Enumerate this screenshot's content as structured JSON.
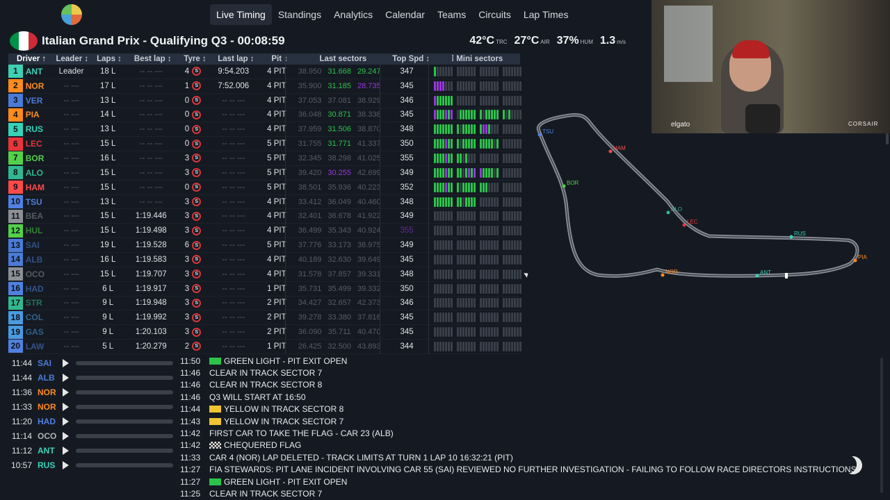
{
  "nav": {
    "items": [
      {
        "label": "Live Timing",
        "active": true
      },
      {
        "label": "Standings"
      },
      {
        "label": "Analytics"
      },
      {
        "label": "Calendar"
      },
      {
        "label": "Teams"
      },
      {
        "label": "Circuits"
      },
      {
        "label": "Lap Times"
      }
    ]
  },
  "session": {
    "title": "Italian Grand Prix - Qualifying Q3 - 00:08:59",
    "flag_colors": [
      "#009246",
      "#ffffff",
      "#ce2b37"
    ]
  },
  "weather": {
    "track_temp": "42°C",
    "track_label": "TRC",
    "air_temp": "27°C",
    "air_label": "AIR",
    "humidity": "37%",
    "humidity_label": "HUM",
    "wind": "1.3",
    "wind_label": "m/s"
  },
  "table": {
    "headers": {
      "driver": "Driver ↑",
      "leader": "Leader ↕",
      "laps": "Laps ↕",
      "best": "Best lap ↕",
      "tyre": "Tyre ↕",
      "last": "Last lap ↕",
      "pit": "Pit ↕",
      "sectors": "Last sectors",
      "speed": "Top Spd ↕",
      "mini": "⁞ Mini sectors"
    },
    "rows": [
      {
        "pos": "1",
        "code": "ANT",
        "color": "#3fd0b4",
        "leader": "Leader",
        "laps": "18 L",
        "best": "-- -- ---",
        "tyre": "4",
        "last": "9:54.203",
        "pit": "4 PIT",
        "s1": "38.950",
        "s2": "31.668",
        "s3": "29.247",
        "s1c": "dim",
        "s2c": "green",
        "s3c": "green",
        "speed": "347",
        "mini": "g..........................",
        "dim": false
      },
      {
        "pos": "2",
        "code": "NOR",
        "color": "#ff8a1e",
        "leader": "-- ---",
        "laps": "17 L",
        "best": "-- -- ---",
        "tyre": "1",
        "last": "7:52.006",
        "pit": "4 PIT",
        "s1": "35.900",
        "s2": "31.185",
        "s3": "28.735",
        "s1c": "dim",
        "s2c": "green",
        "s3c": "purple",
        "speed": "345",
        "mini": "pppp.......................",
        "dim": false
      },
      {
        "pos": "3",
        "code": "VER",
        "color": "#4a7bd8",
        "leader": "-- ---",
        "laps": "13 L",
        "best": "-- -- ---",
        "tyre": "0",
        "last": "-- -- ---",
        "pit": "4 PIT",
        "s1": "37.053",
        "s2": "37.081",
        "s3": "38.929",
        "s1c": "dim",
        "s2c": "dim",
        "s3c": "dim",
        "speed": "346",
        "mini": "pgggggg....................",
        "dim": false
      },
      {
        "pos": "4",
        "code": "PIA",
        "color": "#ff8a1e",
        "leader": "-- ---",
        "laps": "14 L",
        "best": "-- -- ---",
        "tyre": "0",
        "last": "-- -- ---",
        "pit": "4 PIT",
        "s1": "36.048",
        "s2": "30.871",
        "s3": "38.338",
        "s1c": "dim",
        "s2c": "green",
        "s3c": "dim",
        "speed": "345",
        "mini": "pgggpgp.ggggggg.gggggg.g...",
        "dim": false
      },
      {
        "pos": "5",
        "code": "RUS",
        "color": "#35d4b8",
        "leader": "-- ---",
        "laps": "13 L",
        "best": "-- -- ---",
        "tyre": "0",
        "last": "-- -- ---",
        "pit": "4 PIT",
        "s1": "37.959",
        "s2": "31.506",
        "s3": "38.870",
        "s1c": "dim",
        "s2c": "green",
        "s3c": "dim",
        "speed": "348",
        "mini": "gggggggg.ggggggppg.........",
        "dim": false
      },
      {
        "pos": "6",
        "code": "LEC",
        "color": "#e8353a",
        "leader": "-- ---",
        "laps": "15 L",
        "best": "-- -- ---",
        "tyre": "0",
        "last": "-- -- ---",
        "pit": "5 PIT",
        "s1": "31.755",
        "s2": "31.771",
        "s3": "41.337",
        "s1c": "dim",
        "s2c": "green",
        "s3c": "dim",
        "speed": "350",
        "mini": "ggggpggg.gggggggggg.g......",
        "dim": false
      },
      {
        "pos": "7",
        "code": "BOR",
        "color": "#54d04a",
        "leader": "-- ---",
        "laps": "16 L",
        "best": "-- -- ---",
        "tyre": "3",
        "last": "-- -- ---",
        "pit": "5 PIT",
        "s1": "32.345",
        "s2": "38.298",
        "s3": "41.025",
        "s1c": "dim",
        "s2c": "dim",
        "s3c": "dim",
        "speed": "355",
        "mini": "ggggpgggg.g................",
        "dim": false
      },
      {
        "pos": "8",
        "code": "ALO",
        "color": "#32b890",
        "leader": "-- ---",
        "laps": "15 L",
        "best": "-- -- ---",
        "tyre": "3",
        "last": "-- -- ---",
        "pit": "5 PIT",
        "s1": "39.420",
        "s2": "30.255",
        "s3": "42.699",
        "s1c": "dim",
        "s2c": "purple",
        "s3c": "dim",
        "speed": "349",
        "mini": "ggggpgggg.gpgppgggg.g......",
        "dim": false
      },
      {
        "pos": "9",
        "code": "HAM",
        "color": "#ff4a4a",
        "leader": "-- ---",
        "laps": "15 L",
        "best": "-- -- ---",
        "tyre": "0",
        "last": "-- -- ---",
        "pit": "5 PIT",
        "s1": "38.501",
        "s2": "35.936",
        "s3": "40.223",
        "s1c": "dim",
        "s2c": "dim",
        "s3c": "dim",
        "speed": "352",
        "mini": "ggggpggg.gggggggg..........",
        "dim": false
      },
      {
        "pos": "10",
        "code": "TSU",
        "color": "#5080e0",
        "leader": "-- ---",
        "laps": "13 L",
        "best": "-- -- ---",
        "tyre": "3",
        "last": "-- -- ---",
        "pit": "4 PIT",
        "s1": "33.412",
        "s2": "36.049",
        "s3": "40.460",
        "s1c": "dim",
        "s2c": "dim",
        "s3c": "dim",
        "speed": "348",
        "mini": "ggggggggg.gggg.............",
        "dim": false
      },
      {
        "pos": "11",
        "code": "BEA",
        "color": "#8c8f95",
        "leader": "-- ---",
        "laps": "15 L",
        "best": "1:19.446",
        "tyre": "3",
        "last": "-- -- ---",
        "pit": "4 PIT",
        "s1": "32.401",
        "s2": "36.678",
        "s3": "41.922",
        "s1c": "dim",
        "s2c": "dim",
        "s3c": "dim",
        "speed": "349",
        "mini": "...........................",
        "dim": true
      },
      {
        "pos": "12",
        "code": "HUL",
        "color": "#54d04a",
        "leader": "-- ---",
        "laps": "15 L",
        "best": "1:19.498",
        "tyre": "3",
        "last": "-- -- ---",
        "pit": "4 PIT",
        "s1": "36.499",
        "s2": "35.343",
        "s3": "40.924",
        "s1c": "dim",
        "s2c": "dim",
        "s3c": "dim",
        "speed": "355",
        "mini": "...........................",
        "dim": true,
        "speed_purple": true
      },
      {
        "pos": "13",
        "code": "SAI",
        "color": "#4a7bd8",
        "leader": "-- ---",
        "laps": "19 L",
        "best": "1:19.528",
        "tyre": "6",
        "last": "-- -- ---",
        "pit": "5 PIT",
        "s1": "37.776",
        "s2": "33.173",
        "s3": "38.975",
        "s1c": "dim",
        "s2c": "dim",
        "s3c": "dim",
        "speed": "349",
        "mini": "...........................",
        "dim": true
      },
      {
        "pos": "14",
        "code": "ALB",
        "color": "#4a7bd8",
        "leader": "-- ---",
        "laps": "16 L",
        "best": "1:19.583",
        "tyre": "3",
        "last": "-- -- ---",
        "pit": "4 PIT",
        "s1": "40.189",
        "s2": "32.630",
        "s3": "39.649",
        "s1c": "dim",
        "s2c": "dim",
        "s3c": "dim",
        "speed": "345",
        "mini": "...........................",
        "dim": true
      },
      {
        "pos": "15",
        "code": "OCO",
        "color": "#8c8f95",
        "leader": "-- ---",
        "laps": "15 L",
        "best": "1:19.707",
        "tyre": "3",
        "last": "-- -- ---",
        "pit": "4 PIT",
        "s1": "31.578",
        "s2": "37.857",
        "s3": "39.331",
        "s1c": "dim",
        "s2c": "dim",
        "s3c": "dim",
        "speed": "348",
        "mini": "...........................",
        "dim": true
      },
      {
        "pos": "16",
        "code": "HAD",
        "color": "#5080e0",
        "leader": "-- ---",
        "laps": "6 L",
        "best": "1:19.917",
        "tyre": "3",
        "last": "-- -- ---",
        "pit": "1 PIT",
        "s1": "35.731",
        "s2": "35.499",
        "s3": "39.332",
        "s1c": "dim",
        "s2c": "dim",
        "s3c": "dim",
        "speed": "350",
        "mini": "...........................",
        "dim": true
      },
      {
        "pos": "17",
        "code": "STR",
        "color": "#32b890",
        "leader": "-- ---",
        "laps": "9 L",
        "best": "1:19.948",
        "tyre": "3",
        "last": "-- -- ---",
        "pit": "2 PIT",
        "s1": "34.427",
        "s2": "32.657",
        "s3": "42.373",
        "s1c": "dim",
        "s2c": "dim",
        "s3c": "dim",
        "speed": "346",
        "mini": "...........................",
        "dim": true
      },
      {
        "pos": "18",
        "code": "COL",
        "color": "#4a9be0",
        "leader": "-- ---",
        "laps": "9 L",
        "best": "1:19.992",
        "tyre": "3",
        "last": "-- -- ---",
        "pit": "2 PIT",
        "s1": "39.278",
        "s2": "33.380",
        "s3": "37.816",
        "s1c": "dim",
        "s2c": "dim",
        "s3c": "dim",
        "speed": "345",
        "mini": "...........................",
        "dim": true
      },
      {
        "pos": "19",
        "code": "GAS",
        "color": "#4a9be0",
        "leader": "-- ---",
        "laps": "9 L",
        "best": "1:20.103",
        "tyre": "3",
        "last": "-- -- ---",
        "pit": "2 PIT",
        "s1": "36.090",
        "s2": "35.711",
        "s3": "40.470",
        "s1c": "dim",
        "s2c": "dim",
        "s3c": "dim",
        "speed": "345",
        "mini": "...........................",
        "dim": true
      },
      {
        "pos": "20",
        "code": "LAW",
        "color": "#5080e0",
        "leader": "-- ---",
        "laps": "5 L",
        "best": "1:20.279",
        "tyre": "2",
        "last": "-- -- ---",
        "pit": "1 PIT",
        "s1": "26.425",
        "s2": "32.500",
        "s3": "43.893",
        "s1c": "dim",
        "s2c": "dim",
        "s3c": "dim",
        "speed": "344",
        "mini": "...........................",
        "dim": true
      }
    ]
  },
  "map": {
    "labels": [
      {
        "code": "TSU",
        "color": "#5080e0"
      },
      {
        "code": "HAM",
        "color": "#ff4a4a"
      },
      {
        "code": "BOR",
        "color": "#54d04a"
      },
      {
        "code": "ALO",
        "color": "#32b890"
      },
      {
        "code": "LEC",
        "color": "#e8353a"
      },
      {
        "code": "RUS",
        "color": "#35d4b8"
      },
      {
        "code": "PIA",
        "color": "#ff8a1e"
      },
      {
        "code": "NOR",
        "color": "#ff8a1e"
      },
      {
        "code": "ANT",
        "color": "#3fd0b4"
      }
    ]
  },
  "webcam": {
    "brand_left": "elgato",
    "brand_right": "CORSAIR"
  },
  "radio": [
    {
      "time": "11:44",
      "code": "SAI",
      "color": "#4a7bd8"
    },
    {
      "time": "11:44",
      "code": "ALB",
      "color": "#4a7bd8"
    },
    {
      "time": "11:36",
      "code": "NOR",
      "color": "#ff8a1e"
    },
    {
      "time": "11:33",
      "code": "NOR",
      "color": "#ff8a1e"
    },
    {
      "time": "11:20",
      "code": "HAD",
      "color": "#5080e0"
    },
    {
      "time": "11:14",
      "code": "OCO",
      "color": "#b0b3b8"
    },
    {
      "time": "11:12",
      "code": "ANT",
      "color": "#3fd0b4"
    },
    {
      "time": "10:57",
      "code": "RUS",
      "color": "#35d4b8"
    }
  ],
  "race_control": [
    {
      "time": "11:50",
      "flag": "green",
      "text": "GREEN LIGHT - PIT EXIT OPEN"
    },
    {
      "time": "11:46",
      "flag": "",
      "text": "CLEAR IN TRACK SECTOR 7"
    },
    {
      "time": "11:46",
      "flag": "",
      "text": "CLEAR IN TRACK SECTOR 8"
    },
    {
      "time": "11:46",
      "flag": "",
      "text": "Q3 WILL START AT 16:50"
    },
    {
      "time": "11:44",
      "flag": "yellow",
      "text": "YELLOW IN TRACK SECTOR 8"
    },
    {
      "time": "11:43",
      "flag": "yellow",
      "text": "YELLOW IN TRACK SECTOR 7"
    },
    {
      "time": "11:42",
      "flag": "",
      "text": "FIRST CAR TO TAKE THE FLAG - CAR 23 (ALB)"
    },
    {
      "time": "11:42",
      "flag": "chequered",
      "text": "CHEQUERED FLAG"
    },
    {
      "time": "11:33",
      "flag": "",
      "text": "CAR 4 (NOR) LAP DELETED - TRACK LIMITS AT TURN 1 LAP 10 16:32:21 (PIT)"
    },
    {
      "time": "11:27",
      "flag": "",
      "text": "FIA STEWARDS: PIT LANE INCIDENT INVOLVING CAR 55 (SAI) REVIEWED NO FURTHER INVESTIGATION - FAILING TO FOLLOW RACE DIRECTORS INSTRUCTIONS"
    },
    {
      "time": "11:27",
      "flag": "green",
      "text": "GREEN LIGHT - PIT EXIT OPEN"
    },
    {
      "time": "11:25",
      "flag": "",
      "text": "CLEAR IN TRACK SECTOR 7"
    }
  ],
  "colors": {
    "green": "#2bc34a",
    "purple": "#9b35e0",
    "yellow": "#f0c431",
    "dim": "#565c66"
  }
}
